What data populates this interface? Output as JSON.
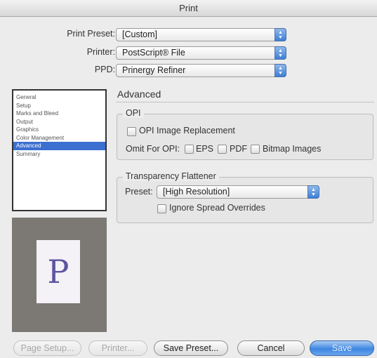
{
  "window": {
    "title": "Print"
  },
  "header": {
    "print_preset": {
      "label": "Print Preset:",
      "value": "[Custom]"
    },
    "printer": {
      "label": "Printer:",
      "value": "PostScript® File"
    },
    "ppd": {
      "label": "PPD:",
      "value": "Prinergy Refiner"
    }
  },
  "sidebar": {
    "items": [
      {
        "label": "General",
        "selected": false
      },
      {
        "label": "Setup",
        "selected": false
      },
      {
        "label": "Marks and Bleed",
        "selected": false
      },
      {
        "label": "Output",
        "selected": false
      },
      {
        "label": "Graphics",
        "selected": false
      },
      {
        "label": "Color Management",
        "selected": false
      },
      {
        "label": "Advanced",
        "selected": true
      },
      {
        "label": "Summary",
        "selected": false
      }
    ]
  },
  "preview": {
    "letter": "P"
  },
  "main": {
    "title": "Advanced",
    "opi": {
      "legend": "OPI",
      "image_replacement_label": "OPI Image Replacement",
      "omit_label": "Omit For OPI:",
      "eps_label": "EPS",
      "pdf_label": "PDF",
      "bitmap_label": "Bitmap Images"
    },
    "flattener": {
      "legend": "Transparency Flattener",
      "preset_label": "Preset:",
      "preset_value": "[High Resolution]",
      "ignore_label": "Ignore Spread Overrides"
    }
  },
  "footer": {
    "page_setup": "Page Setup...",
    "printer": "Printer...",
    "save_preset": "Save Preset...",
    "cancel": "Cancel",
    "save": "Save"
  },
  "colors": {
    "accent": "#3b6fd0",
    "default_button": "#3d86e0"
  }
}
